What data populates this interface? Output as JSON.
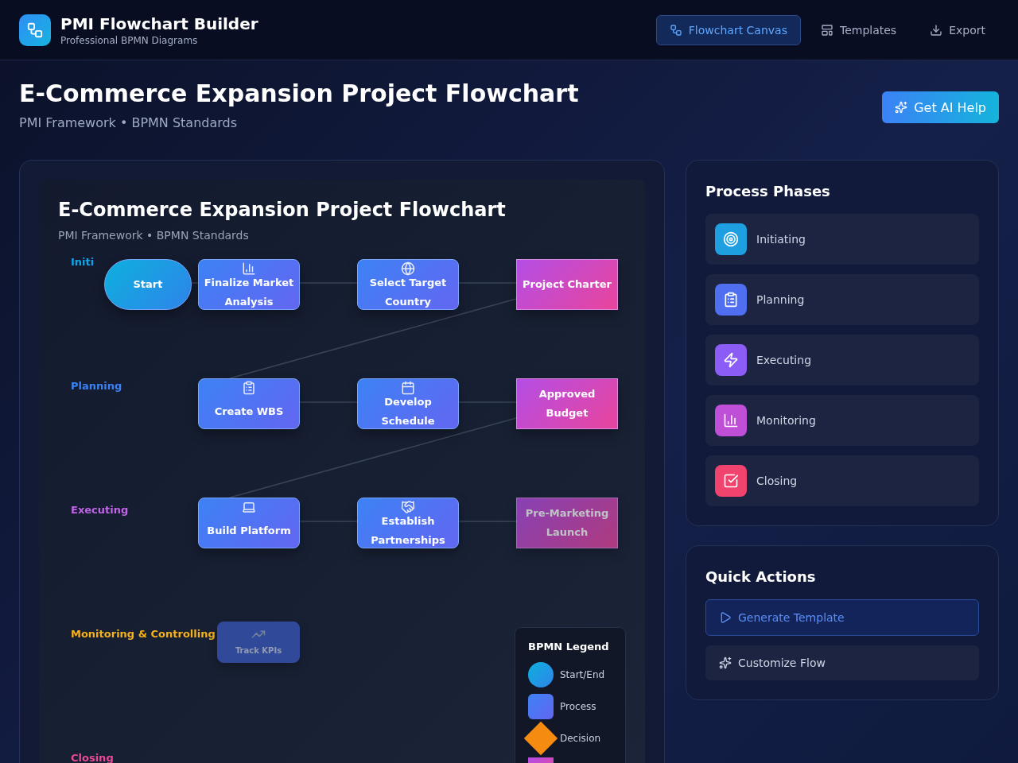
{
  "app": {
    "name": "PMI Flowchart Builder",
    "tagline": "Professional BPMN Diagrams"
  },
  "nav": [
    {
      "label": "Flowchart Canvas",
      "selected": true
    },
    {
      "label": "Templates",
      "selected": false
    },
    {
      "label": "Export",
      "selected": false
    }
  ],
  "page": {
    "title": "E-Commerce Expansion Project Flowchart",
    "subtitle": "PMI Framework • BPMN Standards",
    "ai_button": "Get AI Help"
  },
  "canvas": {
    "title": "E-Commerce Expansion Project Flowchart",
    "subtitle": "PMI Framework • BPMN Standards",
    "lanes": [
      {
        "label": "Initi",
        "color": "#0ea5e9"
      },
      {
        "label": "Planning",
        "color": "#3b82f6"
      },
      {
        "label": "Executing",
        "color": "#c063e6"
      },
      {
        "label": "Monitoring & Controlling",
        "color": "#f5b21a"
      },
      {
        "label": "Closing",
        "color": "#ec4899"
      }
    ],
    "nodes": [
      {
        "kind": "start",
        "label": "Start",
        "faded": false
      },
      {
        "kind": "process",
        "label": "Finalize Market Analysis",
        "faded": false
      },
      {
        "kind": "process",
        "label": "Select Target Country",
        "faded": false
      },
      {
        "kind": "output",
        "label": "Project Charter",
        "faded": false
      },
      {
        "kind": "process",
        "label": "Create WBS",
        "faded": false
      },
      {
        "kind": "process",
        "label": "Develop Schedule",
        "faded": false
      },
      {
        "kind": "output",
        "label": "Approved Budget",
        "faded": false
      },
      {
        "kind": "process",
        "label": "Build Platform",
        "faded": false
      },
      {
        "kind": "process",
        "label": "Establish Partnerships",
        "faded": false
      },
      {
        "kind": "output",
        "label": "Pre-Marketing Launch",
        "faded": true
      },
      {
        "kind": "process",
        "label": "Track KPIs",
        "faded": true
      }
    ],
    "legend": {
      "title": "BPMN Legend",
      "items": [
        {
          "kind": "start",
          "label": "Start/End"
        },
        {
          "kind": "process",
          "label": "Process"
        },
        {
          "kind": "decision",
          "label": "Decision"
        },
        {
          "kind": "output"
        }
      ]
    }
  },
  "phases": {
    "title": "Process Phases",
    "items": [
      {
        "label": "Initiating",
        "color": "#1ea0e0"
      },
      {
        "label": "Planning",
        "color": "#4f6ef0"
      },
      {
        "label": "Executing",
        "color": "#8b5cf6"
      },
      {
        "label": "Monitoring",
        "color": "#c04fd8"
      },
      {
        "label": "Closing",
        "color": "#f0436e"
      }
    ]
  },
  "quick_actions": {
    "title": "Quick Actions",
    "items": [
      {
        "label": "Generate Template",
        "primary": true
      },
      {
        "label": "Customize Flow",
        "primary": false
      }
    ]
  }
}
